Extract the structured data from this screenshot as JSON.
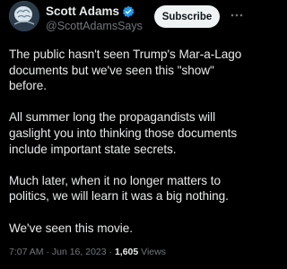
{
  "author": {
    "display_name": "Scott Adams",
    "handle": "@ScottAdamsSays",
    "verified_color": "#1d9bf0"
  },
  "actions": {
    "subscribe_label": "Subscribe",
    "more_icon": "more-horizontal-icon"
  },
  "tweet": {
    "paragraphs": [
      "The public hasn't seen Trump's Mar-a-Lago documents but we've seen this \"show\" before.",
      "All summer long the propagandists will gaslight you into thinking those documents include important state secrets.",
      "Much later, when it no longer matters to politics, we will learn it was a big nothing.",
      "We've seen this movie."
    ]
  },
  "meta": {
    "time": "7:07 AM",
    "separator": "·",
    "date": "Jun 16, 2023",
    "views_count": "1,605",
    "views_label": "Views"
  }
}
